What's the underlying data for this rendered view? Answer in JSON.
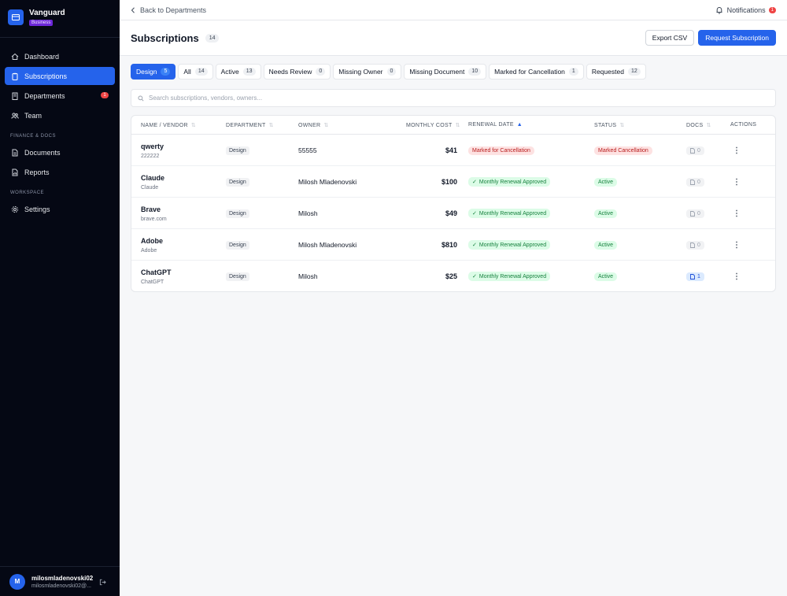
{
  "brand": {
    "name": "Vanguard",
    "plan": "Business"
  },
  "nav": {
    "items": [
      {
        "label": "Dashboard",
        "icon": "home-icon"
      },
      {
        "label": "Subscriptions",
        "icon": "clipboard-icon",
        "active": true
      },
      {
        "label": "Departments",
        "icon": "building-icon",
        "badge": "1"
      },
      {
        "label": "Team",
        "icon": "users-icon"
      }
    ],
    "section_finance": "FINANCE & DOCS",
    "finance_items": [
      {
        "label": "Documents",
        "icon": "document-icon"
      },
      {
        "label": "Reports",
        "icon": "chart-icon"
      }
    ],
    "section_workspace": "WORKSPACE",
    "workspace_items": [
      {
        "label": "Settings",
        "icon": "gear-icon"
      }
    ]
  },
  "user": {
    "initial": "M",
    "name": "milosmladenovski02",
    "email": "milosmladenovski02@..."
  },
  "topbar": {
    "back_label": "Back to Departments",
    "notifications_label": "Notifications",
    "notifications_count": "1"
  },
  "header": {
    "title": "Subscriptions",
    "count": "14",
    "export_label": "Export CSV",
    "request_label": "Request Subscription"
  },
  "filters": [
    {
      "label": "Design",
      "count": "5",
      "active": true
    },
    {
      "label": "All",
      "count": "14"
    },
    {
      "label": "Active",
      "count": "13"
    },
    {
      "label": "Needs Review",
      "count": "0"
    },
    {
      "label": "Missing Owner",
      "count": "0"
    },
    {
      "label": "Missing Document",
      "count": "10"
    },
    {
      "label": "Marked for Cancellation",
      "count": "1"
    },
    {
      "label": "Requested",
      "count": "12"
    }
  ],
  "search": {
    "placeholder": "Search subscriptions, vendors, owners..."
  },
  "table": {
    "columns": {
      "name": "NAME / VENDOR",
      "department": "DEPARTMENT",
      "owner": "OWNER",
      "cost": "MONTHLY COST",
      "renewal": "RENEWAL DATE",
      "status": "STATUS",
      "docs": "DOCS",
      "actions": "ACTIONS"
    },
    "rows": [
      {
        "name": "qwerty",
        "vendor": "222222",
        "department": "Design",
        "owner": "55555",
        "cost": "$41",
        "renewal": "Marked for Cancellation",
        "renewal_type": "warn",
        "status": "Marked Cancellation",
        "status_type": "warn",
        "docs": "0"
      },
      {
        "name": "Claude",
        "vendor": "Claude",
        "department": "Design",
        "owner": "Milosh Mladenovski",
        "cost": "$100",
        "renewal": "Monthly Renewal Approved",
        "renewal_type": "ok",
        "status": "Active",
        "status_type": "ok",
        "docs": "0"
      },
      {
        "name": "Brave",
        "vendor": "brave.com",
        "department": "Design",
        "owner": "Milosh",
        "cost": "$49",
        "renewal": "Monthly Renewal Approved",
        "renewal_type": "ok",
        "status": "Active",
        "status_type": "ok",
        "docs": "0"
      },
      {
        "name": "Adobe",
        "vendor": "Adobe",
        "department": "Design",
        "owner": "Milosh Mladenovski",
        "cost": "$810",
        "renewal": "Monthly Renewal Approved",
        "renewal_type": "ok",
        "status": "Active",
        "status_type": "ok",
        "docs": "0"
      },
      {
        "name": "ChatGPT",
        "vendor": "ChatGPT",
        "department": "Design",
        "owner": "Milosh",
        "cost": "$25",
        "renewal": "Monthly Renewal Approved",
        "renewal_type": "ok",
        "status": "Active",
        "status_type": "ok",
        "docs": "1"
      }
    ]
  },
  "colors": {
    "accent": "#2563eb",
    "sidebar_bg": "#050814",
    "danger": "#ef4444",
    "success": "#15803d"
  }
}
